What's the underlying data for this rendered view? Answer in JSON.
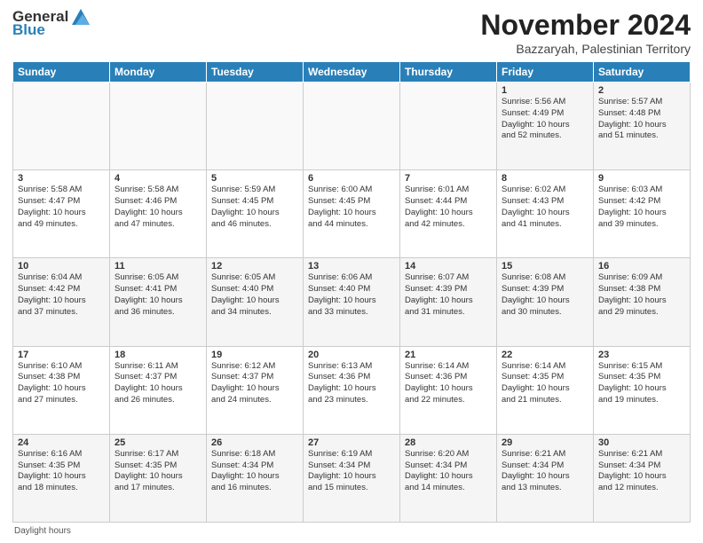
{
  "header": {
    "logo_general": "General",
    "logo_blue": "Blue",
    "month_title": "November 2024",
    "location": "Bazzaryah, Palestinian Territory"
  },
  "columns": [
    "Sunday",
    "Monday",
    "Tuesday",
    "Wednesday",
    "Thursday",
    "Friday",
    "Saturday"
  ],
  "weeks": [
    [
      {
        "day": "",
        "info": ""
      },
      {
        "day": "",
        "info": ""
      },
      {
        "day": "",
        "info": ""
      },
      {
        "day": "",
        "info": ""
      },
      {
        "day": "",
        "info": ""
      },
      {
        "day": "1",
        "info": "Sunrise: 5:56 AM\nSunset: 4:49 PM\nDaylight: 10 hours\nand 52 minutes."
      },
      {
        "day": "2",
        "info": "Sunrise: 5:57 AM\nSunset: 4:48 PM\nDaylight: 10 hours\nand 51 minutes."
      }
    ],
    [
      {
        "day": "3",
        "info": "Sunrise: 5:58 AM\nSunset: 4:47 PM\nDaylight: 10 hours\nand 49 minutes."
      },
      {
        "day": "4",
        "info": "Sunrise: 5:58 AM\nSunset: 4:46 PM\nDaylight: 10 hours\nand 47 minutes."
      },
      {
        "day": "5",
        "info": "Sunrise: 5:59 AM\nSunset: 4:45 PM\nDaylight: 10 hours\nand 46 minutes."
      },
      {
        "day": "6",
        "info": "Sunrise: 6:00 AM\nSunset: 4:45 PM\nDaylight: 10 hours\nand 44 minutes."
      },
      {
        "day": "7",
        "info": "Sunrise: 6:01 AM\nSunset: 4:44 PM\nDaylight: 10 hours\nand 42 minutes."
      },
      {
        "day": "8",
        "info": "Sunrise: 6:02 AM\nSunset: 4:43 PM\nDaylight: 10 hours\nand 41 minutes."
      },
      {
        "day": "9",
        "info": "Sunrise: 6:03 AM\nSunset: 4:42 PM\nDaylight: 10 hours\nand 39 minutes."
      }
    ],
    [
      {
        "day": "10",
        "info": "Sunrise: 6:04 AM\nSunset: 4:42 PM\nDaylight: 10 hours\nand 37 minutes."
      },
      {
        "day": "11",
        "info": "Sunrise: 6:05 AM\nSunset: 4:41 PM\nDaylight: 10 hours\nand 36 minutes."
      },
      {
        "day": "12",
        "info": "Sunrise: 6:05 AM\nSunset: 4:40 PM\nDaylight: 10 hours\nand 34 minutes."
      },
      {
        "day": "13",
        "info": "Sunrise: 6:06 AM\nSunset: 4:40 PM\nDaylight: 10 hours\nand 33 minutes."
      },
      {
        "day": "14",
        "info": "Sunrise: 6:07 AM\nSunset: 4:39 PM\nDaylight: 10 hours\nand 31 minutes."
      },
      {
        "day": "15",
        "info": "Sunrise: 6:08 AM\nSunset: 4:39 PM\nDaylight: 10 hours\nand 30 minutes."
      },
      {
        "day": "16",
        "info": "Sunrise: 6:09 AM\nSunset: 4:38 PM\nDaylight: 10 hours\nand 29 minutes."
      }
    ],
    [
      {
        "day": "17",
        "info": "Sunrise: 6:10 AM\nSunset: 4:38 PM\nDaylight: 10 hours\nand 27 minutes."
      },
      {
        "day": "18",
        "info": "Sunrise: 6:11 AM\nSunset: 4:37 PM\nDaylight: 10 hours\nand 26 minutes."
      },
      {
        "day": "19",
        "info": "Sunrise: 6:12 AM\nSunset: 4:37 PM\nDaylight: 10 hours\nand 24 minutes."
      },
      {
        "day": "20",
        "info": "Sunrise: 6:13 AM\nSunset: 4:36 PM\nDaylight: 10 hours\nand 23 minutes."
      },
      {
        "day": "21",
        "info": "Sunrise: 6:14 AM\nSunset: 4:36 PM\nDaylight: 10 hours\nand 22 minutes."
      },
      {
        "day": "22",
        "info": "Sunrise: 6:14 AM\nSunset: 4:35 PM\nDaylight: 10 hours\nand 21 minutes."
      },
      {
        "day": "23",
        "info": "Sunrise: 6:15 AM\nSunset: 4:35 PM\nDaylight: 10 hours\nand 19 minutes."
      }
    ],
    [
      {
        "day": "24",
        "info": "Sunrise: 6:16 AM\nSunset: 4:35 PM\nDaylight: 10 hours\nand 18 minutes."
      },
      {
        "day": "25",
        "info": "Sunrise: 6:17 AM\nSunset: 4:35 PM\nDaylight: 10 hours\nand 17 minutes."
      },
      {
        "day": "26",
        "info": "Sunrise: 6:18 AM\nSunset: 4:34 PM\nDaylight: 10 hours\nand 16 minutes."
      },
      {
        "day": "27",
        "info": "Sunrise: 6:19 AM\nSunset: 4:34 PM\nDaylight: 10 hours\nand 15 minutes."
      },
      {
        "day": "28",
        "info": "Sunrise: 6:20 AM\nSunset: 4:34 PM\nDaylight: 10 hours\nand 14 minutes."
      },
      {
        "day": "29",
        "info": "Sunrise: 6:21 AM\nSunset: 4:34 PM\nDaylight: 10 hours\nand 13 minutes."
      },
      {
        "day": "30",
        "info": "Sunrise: 6:21 AM\nSunset: 4:34 PM\nDaylight: 10 hours\nand 12 minutes."
      }
    ]
  ],
  "footer": {
    "label": "Daylight hours"
  }
}
